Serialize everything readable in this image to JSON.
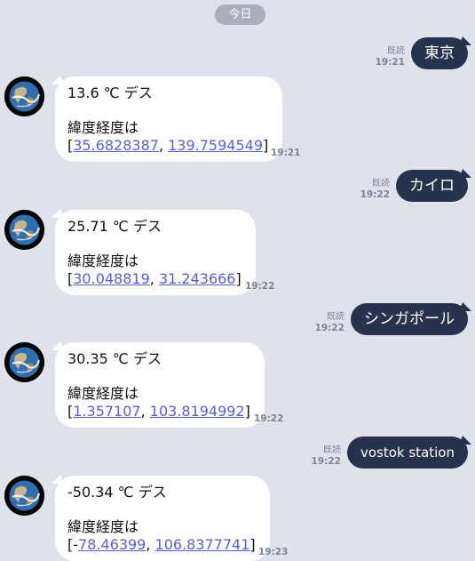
{
  "date_label": "今日",
  "read_label": "既読",
  "messages_out": [
    {
      "text": "東京",
      "time": "19:21"
    },
    {
      "text": "カイロ",
      "time": "19:22"
    },
    {
      "text": "シンガポール",
      "time": "19:22"
    },
    {
      "text": "vostok station",
      "time": "19:22"
    }
  ],
  "messages_in": [
    {
      "temp": "13.6 ℃ デス",
      "coords_label": "緯度経度は",
      "open": "[",
      "lat": "35.6828387",
      "sep": ", ",
      "lng": "139.7594549",
      "close": "]",
      "time": "19:21"
    },
    {
      "temp": "25.71 ℃ デス",
      "coords_label": "緯度経度は",
      "open": "[",
      "lat": "30.048819",
      "sep": ", ",
      "lng": "31.243666",
      "close": "]",
      "time": "19:22"
    },
    {
      "temp": "30.35 ℃ デス",
      "coords_label": "緯度経度は",
      "open": "[",
      "lat": "1.357107",
      "sep": ", ",
      "lng": "103.8194992",
      "close": "]",
      "time": "19:22"
    },
    {
      "temp": "-50.34 ℃ デス",
      "coords_label": "緯度経度は",
      "open": "[-",
      "lat": "78.46399",
      "sep": ", ",
      "lng": "106.8377741",
      "close": "]",
      "time": "19:23"
    }
  ],
  "colors": {
    "background": "#dfe2ea",
    "outgoing_bubble": "#27324d",
    "incoming_bubble": "#ffffff",
    "link": "#5a5fcf"
  },
  "icons": {
    "avatar": "earth-globe-icon"
  }
}
